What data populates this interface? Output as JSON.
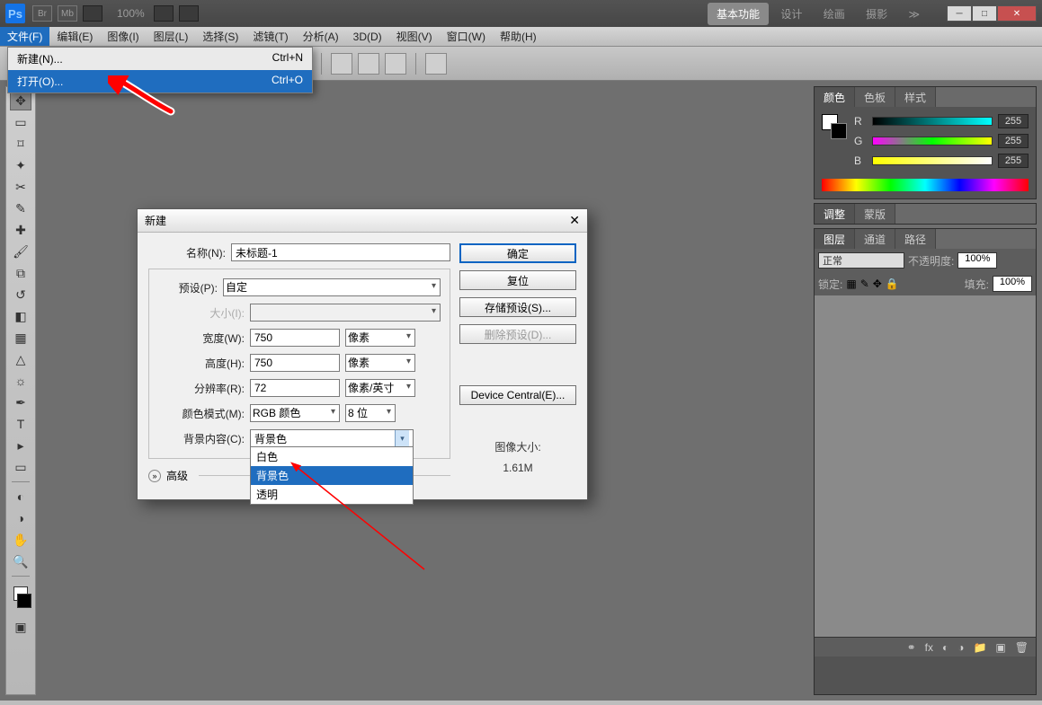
{
  "titlebar": {
    "app_badge": "Ps",
    "zoom": "100%",
    "workspaces": [
      "基本功能",
      "设计",
      "绘画",
      "摄影"
    ],
    "ws_more": "≫"
  },
  "menus": [
    "文件(F)",
    "编辑(E)",
    "图像(I)",
    "图层(L)",
    "选择(S)",
    "滤镜(T)",
    "分析(A)",
    "3D(D)",
    "视图(V)",
    "窗口(W)",
    "帮助(H)"
  ],
  "filemenu": {
    "new_label": "新建(N)...",
    "new_sc": "Ctrl+N",
    "open_label": "打开(O)...",
    "open_sc": "Ctrl+O"
  },
  "panels": {
    "color_tabs": [
      "颜色",
      "色板",
      "样式"
    ],
    "r": "R",
    "g": "G",
    "b": "B",
    "rv": "255",
    "gv": "255",
    "bv": "255",
    "adjust_tabs": [
      "调整",
      "蒙版"
    ],
    "layer_tabs": [
      "图层",
      "通道",
      "路径"
    ],
    "blend_mode": "正常",
    "opacity_label": "不透明度:",
    "opacity_val": "100%",
    "lock_label": "锁定:",
    "fill_label": "填充:",
    "fill_val": "100%"
  },
  "dialog": {
    "title": "新建",
    "name_label": "名称(N):",
    "name_val": "未标题-1",
    "preset_label": "预设(P):",
    "preset_val": "自定",
    "size_label": "大小(I):",
    "width_label": "宽度(W):",
    "width_val": "750",
    "width_unit": "像素",
    "height_label": "高度(H):",
    "height_val": "750",
    "height_unit": "像素",
    "res_label": "分辨率(R):",
    "res_val": "72",
    "res_unit": "像素/英寸",
    "mode_label": "颜色模式(M):",
    "mode_val": "RGB 颜色",
    "depth_val": "8 位",
    "bg_label": "背景内容(C):",
    "bg_val": "背景色",
    "bg_options": [
      "白色",
      "背景色",
      "透明"
    ],
    "adv_label": "高级",
    "info_label": "图像大小:",
    "info_val": "1.61M",
    "ok": "确定",
    "reset": "复位",
    "save_preset": "存储预设(S)...",
    "del_preset": "删除预设(D)...",
    "device_central": "Device Central(E)..."
  }
}
